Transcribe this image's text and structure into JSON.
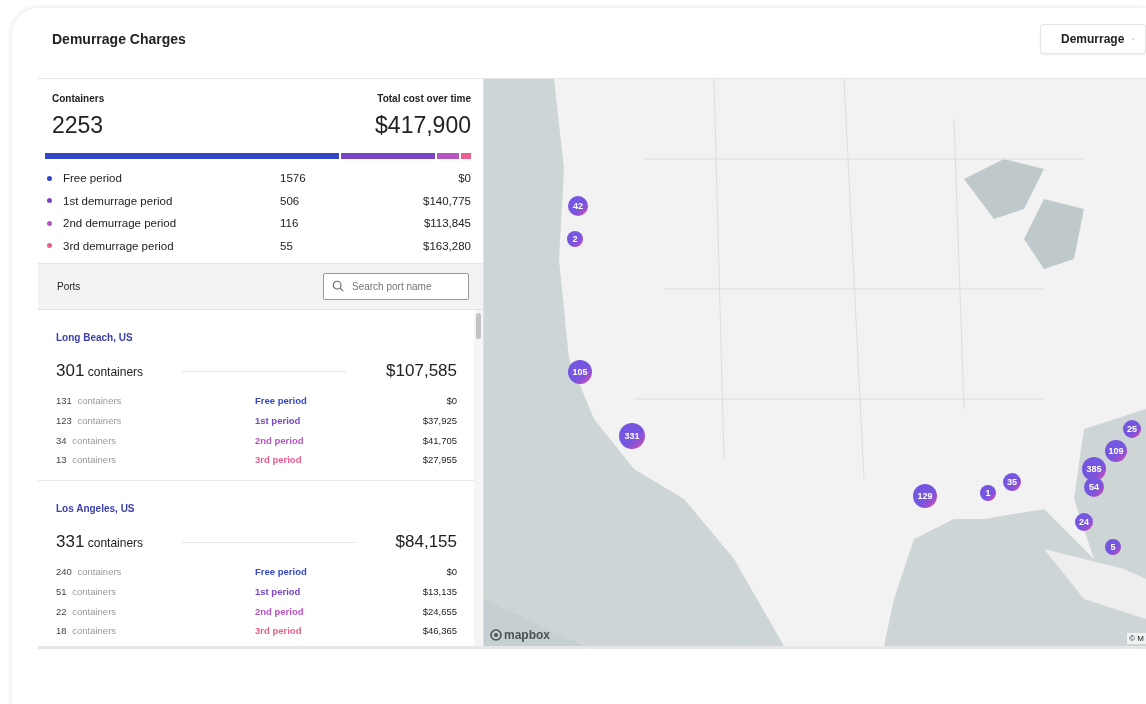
{
  "header": {
    "title": "Demurrage Charges",
    "dropdown": {
      "value": "Demurrage"
    }
  },
  "summary": {
    "containers_label": "Containers",
    "containers": "2253",
    "cost_label": "Total cost over time",
    "cost": "$417,900",
    "periods": [
      {
        "name": "Free period",
        "count": "1576",
        "cost": "$0",
        "color": "#3346c8"
      },
      {
        "name": "1st demurrage period",
        "count": "506",
        "cost": "$140,775",
        "color": "#7b45c8"
      },
      {
        "name": "2nd demurrage period",
        "count": "116",
        "cost": "$113,845",
        "color": "#b655c0"
      },
      {
        "name": "3rd demurrage period",
        "count": "55",
        "cost": "$163,280",
        "color": "#ec5d8f"
      }
    ]
  },
  "ports": {
    "title": "Ports",
    "search": {
      "placeholder": "Search port name"
    },
    "items": [
      {
        "name": "Long Beach, US",
        "count": "301",
        "unit": "containers",
        "total": "$107,585",
        "rows": [
          {
            "count": "131",
            "unit": "containers",
            "period": "Free period",
            "color": "#3346c8",
            "cost": "$0"
          },
          {
            "count": "123",
            "unit": "containers",
            "period": "1st period",
            "color": "#7b45c8",
            "cost": "$37,925"
          },
          {
            "count": "34",
            "unit": "containers",
            "period": "2nd period",
            "color": "#b655c0",
            "cost": "$41,705"
          },
          {
            "count": "13",
            "unit": "containers",
            "period": "3rd period",
            "color": "#ec5d8f",
            "cost": "$27,955"
          }
        ]
      },
      {
        "name": "Los Angeles, US",
        "count": "331",
        "unit": "containers",
        "total": "$84,155",
        "rows": [
          {
            "count": "240",
            "unit": "containers",
            "period": "Free period",
            "color": "#3346c8",
            "cost": "$0"
          },
          {
            "count": "51",
            "unit": "containers",
            "period": "1st period",
            "color": "#7b45c8",
            "cost": "$13,135"
          },
          {
            "count": "22",
            "unit": "containers",
            "period": "2nd period",
            "color": "#b655c0",
            "cost": "$24,655"
          },
          {
            "count": "18",
            "unit": "containers",
            "period": "3rd period",
            "color": "#ec5d8f",
            "cost": "$46,365"
          }
        ]
      }
    ]
  },
  "map": {
    "markers": [
      {
        "count": "42"
      },
      {
        "count": "2"
      },
      {
        "count": "105"
      },
      {
        "count": "331"
      },
      {
        "count": "25"
      },
      {
        "count": "109"
      },
      {
        "count": "385"
      },
      {
        "count": "129"
      },
      {
        "count": "1"
      },
      {
        "count": "35"
      },
      {
        "count": "54"
      },
      {
        "count": "24"
      },
      {
        "count": "5"
      }
    ],
    "logo": "mapbox",
    "attribution": "© M"
  }
}
